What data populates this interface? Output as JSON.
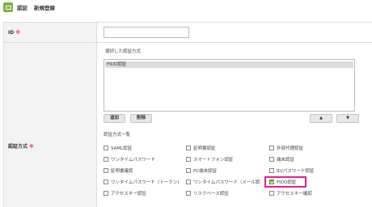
{
  "header": {
    "app_title": "認証",
    "page_title": "新規登録"
  },
  "form": {
    "id": {
      "label": "ID",
      "required_mark": "※",
      "value": ""
    },
    "auth_method": {
      "label": "認証方式",
      "required_mark": "※",
      "selected_label": "選択した認証方式",
      "selected_items": [
        "FIDO認証"
      ],
      "add_button": "追加",
      "delete_button": "削除",
      "up_button": "▲",
      "down_button": "▼",
      "list_label": "認証方式一覧",
      "options": [
        {
          "label": "SAML認証",
          "checked": false
        },
        {
          "label": "証明書認証",
          "checked": false
        },
        {
          "label": "外部代理認証",
          "checked": false
        },
        {
          "label": "ワンタイムパスワード",
          "checked": false
        },
        {
          "label": "スマートフォン認証",
          "checked": false
        },
        {
          "label": "端末認証",
          "checked": false
        },
        {
          "label": "証明書確認",
          "checked": false
        },
        {
          "label": "PC端末認証",
          "checked": false
        },
        {
          "label": "ID/パスワード認証",
          "checked": false
        },
        {
          "label": "ワンタイムパスワード（トークン）",
          "checked": false
        },
        {
          "label": "ワンタイムパスワード（メール認",
          "checked": false
        },
        {
          "label": "FIDO認証",
          "checked": true
        },
        {
          "label": "アクセスキー認証",
          "checked": false
        },
        {
          "label": "リスクベース認証",
          "checked": false
        },
        {
          "label": "アクセスキー確認",
          "checked": false
        }
      ]
    }
  },
  "colors": {
    "logo": "#7cb342",
    "required": "#e53935",
    "highlight": "#e91e8c",
    "label_bg": "#f3f3f3"
  }
}
